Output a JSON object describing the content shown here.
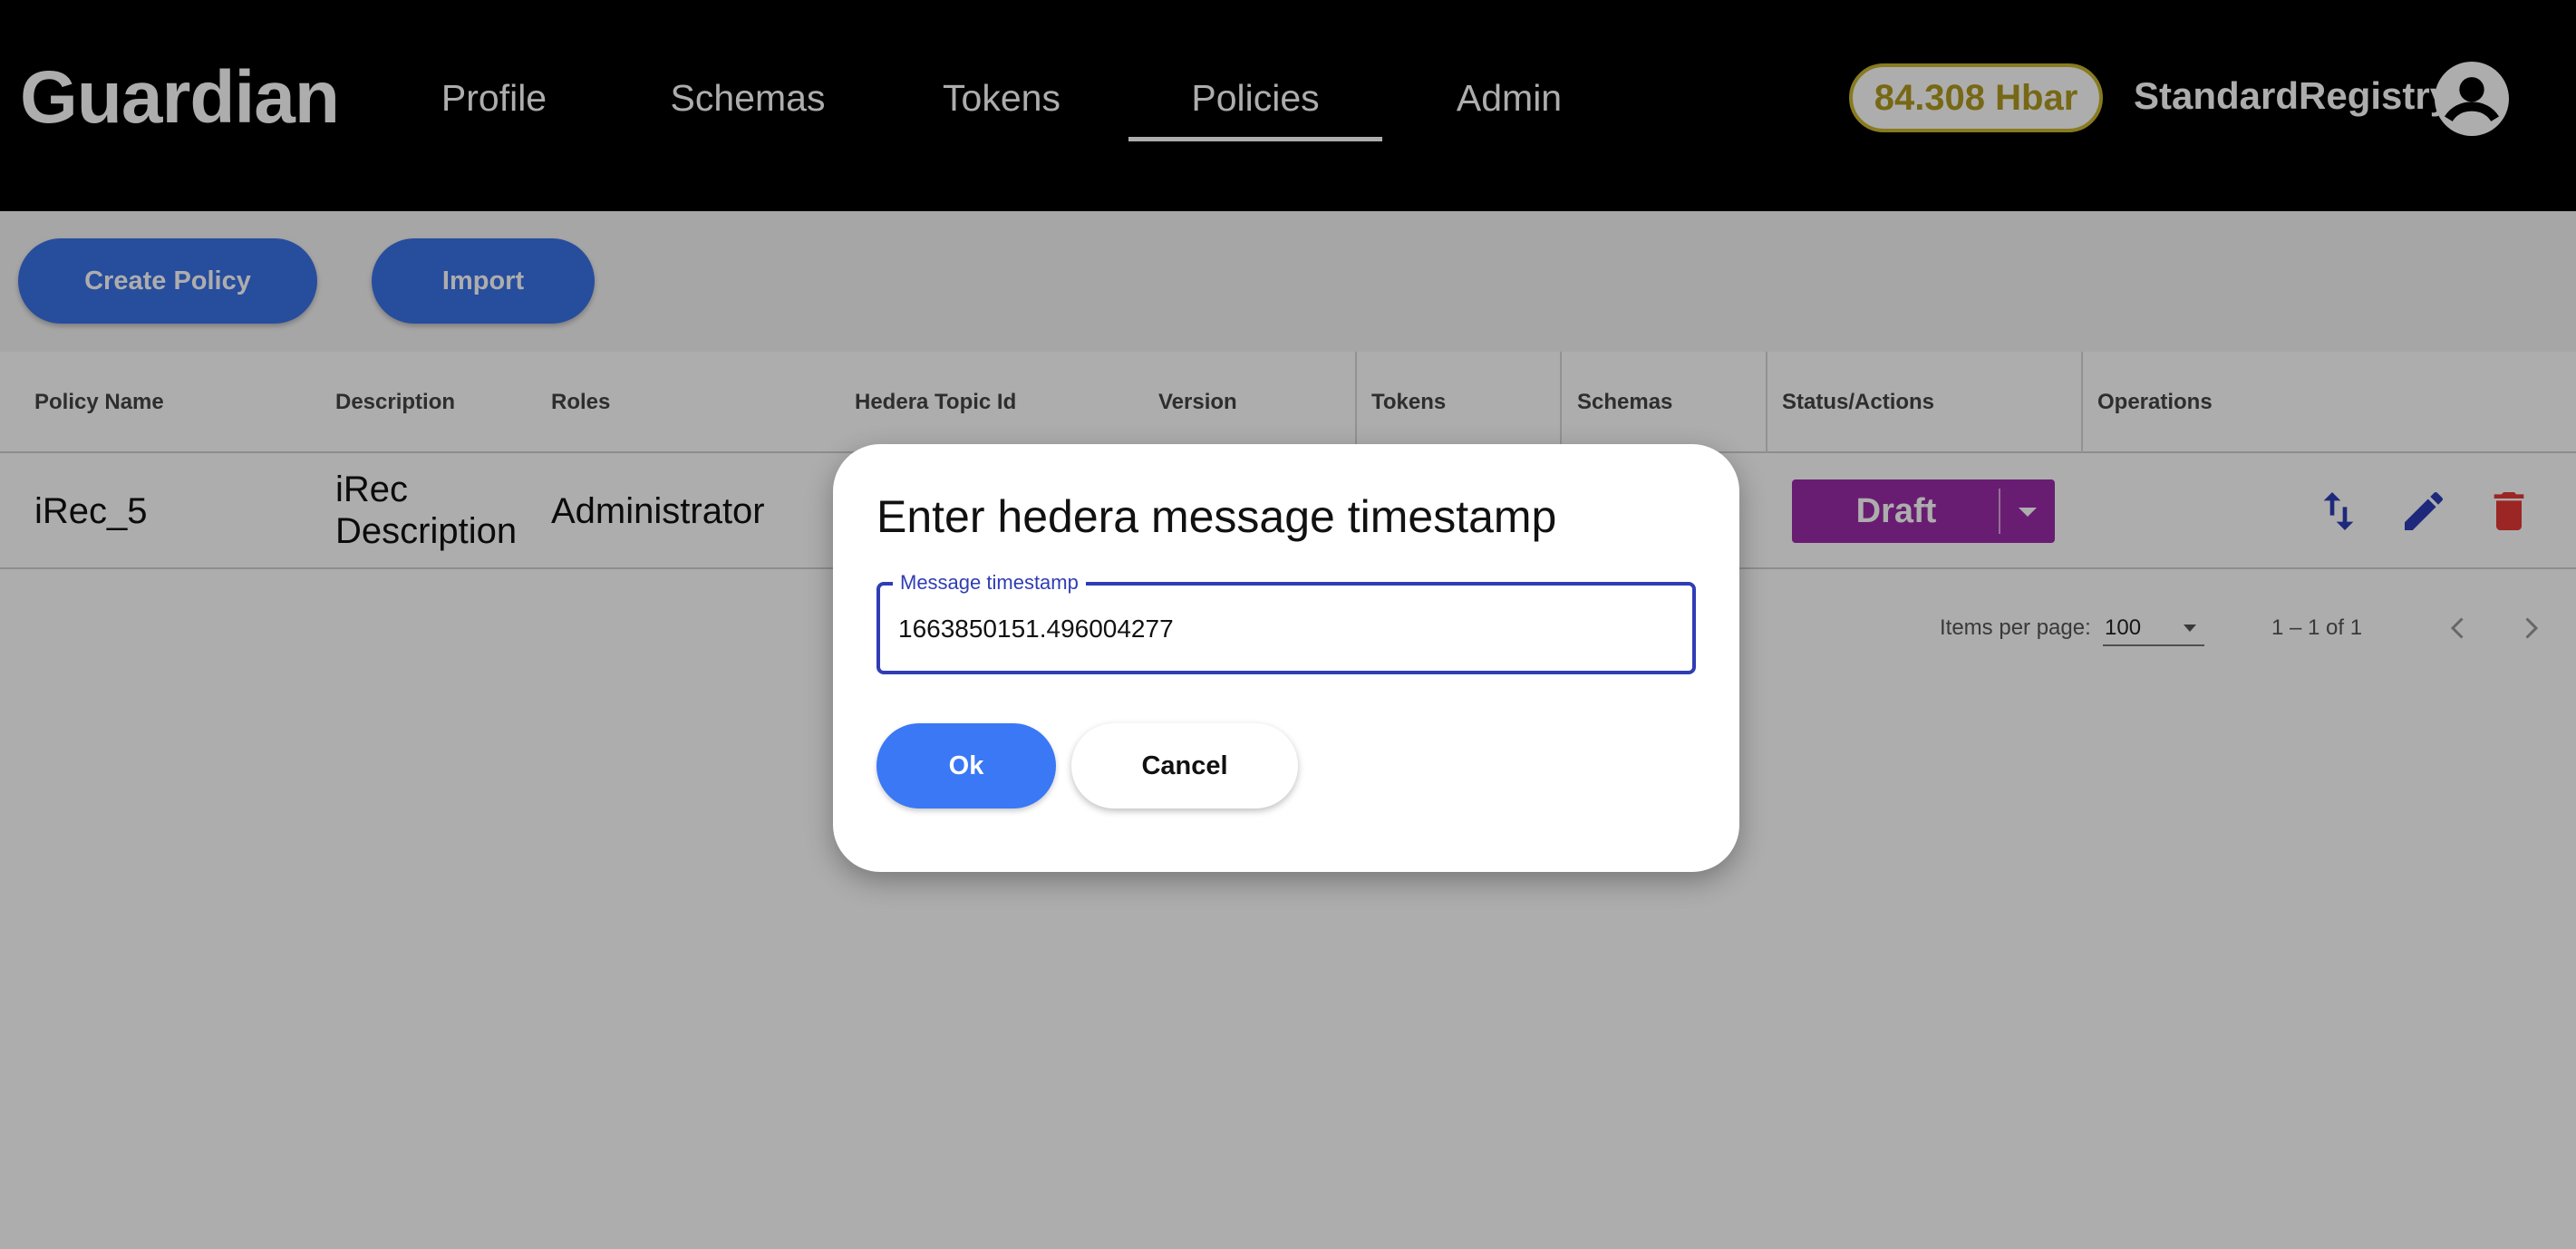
{
  "header": {
    "logo": "Guardian",
    "nav": [
      "Profile",
      "Schemas",
      "Tokens",
      "Policies",
      "Admin"
    ],
    "active_nav": "Policies",
    "balance": "84.308 Hbar",
    "username": "StandardRegistry"
  },
  "toolbar": {
    "create_label": "Create Policy",
    "import_label": "Import"
  },
  "table": {
    "columns": [
      "Policy Name",
      "Description",
      "Roles",
      "Hedera Topic Id",
      "Version",
      "Tokens",
      "Schemas",
      "Status/Actions",
      "Operations"
    ],
    "row": {
      "policy_name": "iRec_5",
      "description_line1": "iRec",
      "description_line2": "Description",
      "roles": "Administrator",
      "status": "Draft"
    },
    "operations_icons": [
      "import-export-icon",
      "edit-icon",
      "delete-icon"
    ]
  },
  "paginator": {
    "items_per_page_label": "Items per page:",
    "items_per_page_value": "100",
    "range": "1 – 1 of 1"
  },
  "dialog": {
    "title": "Enter hedera message timestamp",
    "field_label": "Message timestamp",
    "field_value": "1663850151.496004277",
    "ok_label": "Ok",
    "cancel_label": "Cancel"
  },
  "colors": {
    "header_bg": "#000000",
    "primary_button": "#3a72e8",
    "status_draft": "#9b2ba8",
    "delete_icon": "#e53935",
    "field_border": "#2f3db5",
    "balance_border": "#c9b530"
  }
}
